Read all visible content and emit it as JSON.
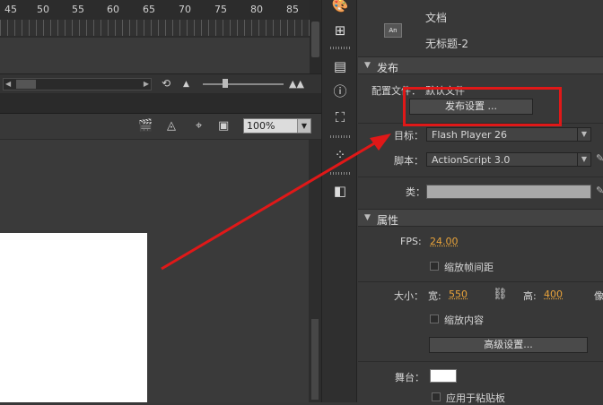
{
  "timeline": {
    "ruler_numbers": [
      "45",
      "50",
      "55",
      "60",
      "65",
      "70",
      "75",
      "80",
      "85"
    ]
  },
  "stage": {
    "zoom_value": "100%"
  },
  "properties": {
    "doc_icon_text": "An",
    "doc_type": "文档",
    "doc_name": "无标题-2",
    "publish": {
      "header": "发布",
      "profile_label": "配置文件：",
      "profile_value": "默认文件",
      "publish_settings_button": "发布设置 ...",
      "target_label": "目标：",
      "target_value": "Flash Player 26",
      "script_label": "脚本：",
      "script_value": "ActionScript 3.0",
      "class_label": "类："
    },
    "attributes": {
      "header": "属性",
      "fps_label": "FPS:",
      "fps_value": "24.00",
      "scale_span_label": "缩放帧间距",
      "size_label": "大小：",
      "width_label": "宽:",
      "width_value": "550",
      "height_label": "高:",
      "height_value": "400",
      "unit_label": "像",
      "scale_content_label": "缩放内容",
      "advanced_button": "高级设置...",
      "stage_label": "舞台：",
      "stage_color": "#ffffff",
      "apply_pasteboard_label": "应用于粘贴板"
    }
  },
  "colors": {
    "annotation": "#e01818",
    "accent_value": "#e9a33a"
  }
}
